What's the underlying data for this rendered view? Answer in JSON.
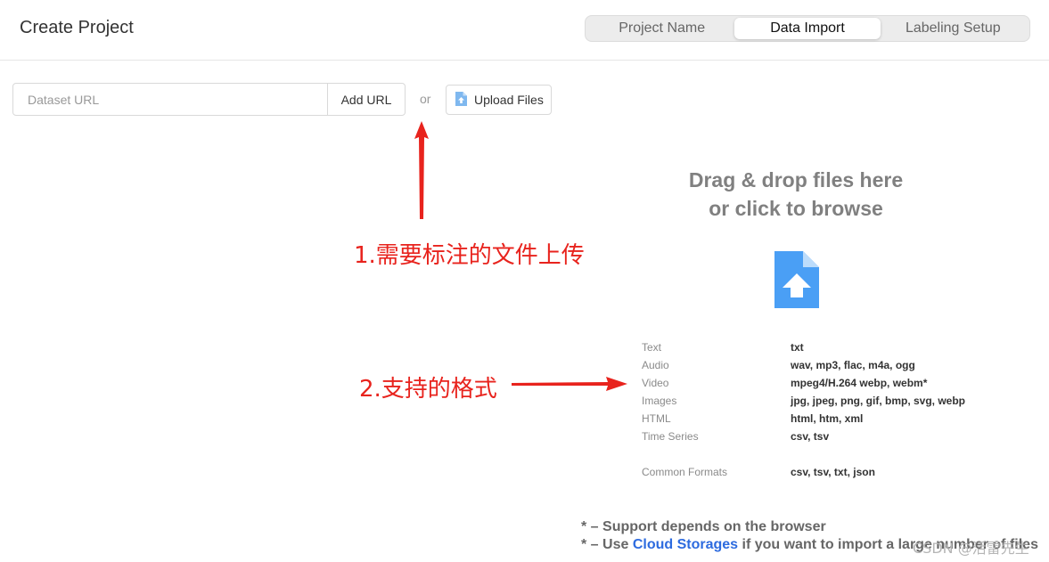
{
  "header": {
    "title": "Create Project",
    "steps": [
      {
        "label": "Project Name",
        "active": false
      },
      {
        "label": "Data Import",
        "active": true
      },
      {
        "label": "Labeling Setup",
        "active": false
      }
    ]
  },
  "import_bar": {
    "url_placeholder": "Dataset URL",
    "add_url_label": "Add URL",
    "or_text": "or",
    "upload_files_label": "Upload Files"
  },
  "dropzone": {
    "title_line1": "Drag & drop files here",
    "title_line2": "or click to browse",
    "icon": "file-upload-icon",
    "accent_color": "#4a9ff5"
  },
  "formats": [
    {
      "type": "Text",
      "extensions": "txt"
    },
    {
      "type": "Audio",
      "extensions": "wav, mp3, flac, m4a, ogg"
    },
    {
      "type": "Video",
      "extensions": "mpeg4/H.264 webp, webm*"
    },
    {
      "type": "Images",
      "extensions": "jpg, jpeg, png, gif, bmp, svg, webp"
    },
    {
      "type": "HTML",
      "extensions": "html, htm, xml"
    },
    {
      "type": "Time Series",
      "extensions": "csv, tsv"
    },
    {
      "type": "Common Formats",
      "extensions": "csv, tsv, txt, json"
    }
  ],
  "notes": {
    "note1": "* – Support depends on the browser",
    "note2_prefix": "* – Use ",
    "note2_link": "Cloud Storages",
    "note2_suffix": " if you want to import a large number of files"
  },
  "annotations": {
    "upload_note": "1.需要标注的文件上传",
    "formats_note": "2.支持的格式",
    "color": "#e8231d"
  },
  "watermark": "CSDN @活雷先生"
}
